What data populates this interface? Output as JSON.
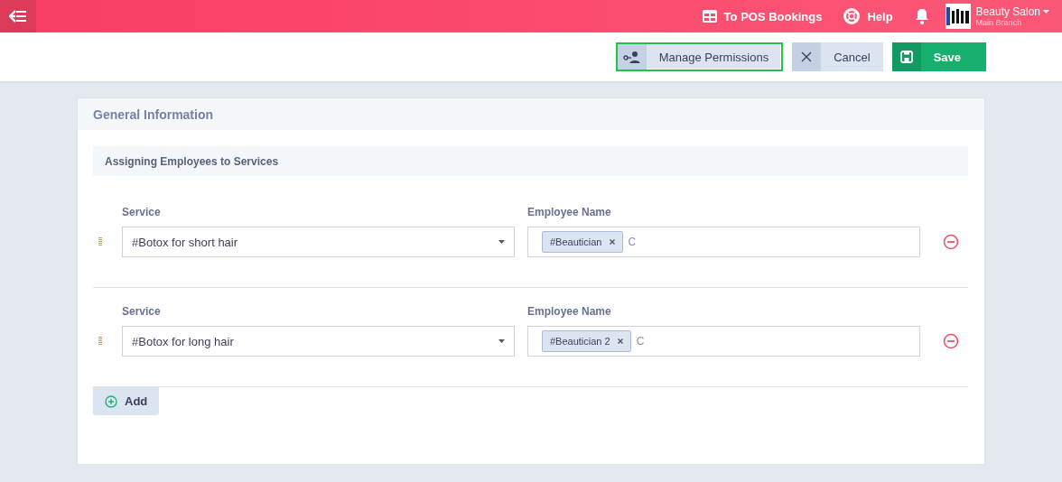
{
  "topbar": {
    "links": [
      {
        "kind": "pos",
        "label": "To POS Bookings"
      },
      {
        "kind": "help",
        "label": "Help"
      }
    ],
    "account": {
      "name": "Beauty Salon",
      "branch": "Main Branch"
    }
  },
  "toolbar": {
    "buttons": [
      {
        "kind": "permissions",
        "label": "Manage Permissions",
        "focused": true
      },
      {
        "kind": "cancel",
        "label": "Cancel",
        "focused": false
      },
      {
        "kind": "save",
        "label": "Save",
        "focused": false
      }
    ]
  },
  "card": {
    "title": "General Information",
    "section": "Assigning Employees to Services",
    "rows": [
      {
        "service_label": "Service",
        "service": "#Botox for short hair",
        "employee_label": "Employee Name",
        "employees": [
          "#Beautician"
        ],
        "typed": "C"
      },
      {
        "service_label": "Service",
        "service": "#Botox for long hair",
        "employee_label": "Employee Name",
        "employees": [
          "#Beautician 2"
        ],
        "typed": "C"
      }
    ],
    "add_label": "Add"
  }
}
